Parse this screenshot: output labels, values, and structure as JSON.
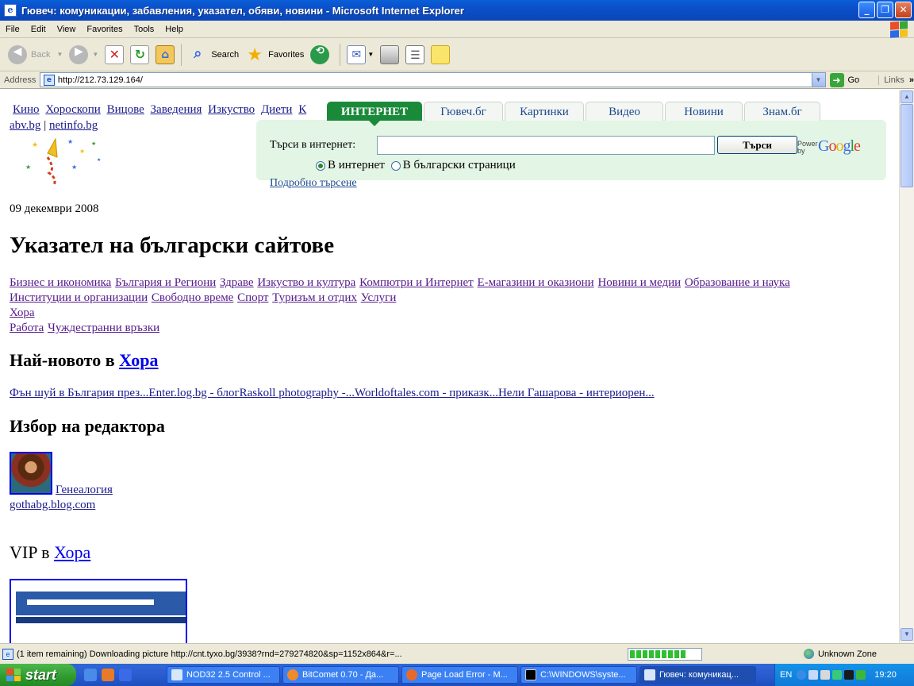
{
  "window": {
    "title": "Гювеч: комуникации, забавления, указател, обяви, новини - Microsoft Internet Explorer",
    "controls": [
      "minimize",
      "maximize",
      "close"
    ]
  },
  "menu": [
    "File",
    "Edit",
    "View",
    "Favorites",
    "Tools",
    "Help"
  ],
  "toolbar": {
    "back_label": "Back",
    "search_label": "Search",
    "favorites_label": "Favorites"
  },
  "address": {
    "label": "Address",
    "url": "http://212.73.129.164/",
    "go_label": "Go",
    "links_label": "Links"
  },
  "page": {
    "top_nav": [
      "Кино",
      "Хороскопи",
      "Вицове",
      "Заведения",
      "Изкуство",
      "Диети",
      "К"
    ],
    "top_links": [
      "abv.bg",
      "netinfo.bg"
    ],
    "tabs": [
      {
        "label": "ИНТЕРНЕТ",
        "active": true
      },
      {
        "label": "Гювеч.бг",
        "active": false
      },
      {
        "label": "Картинки",
        "active": false
      },
      {
        "label": "Видео",
        "active": false
      },
      {
        "label": "Новини",
        "active": false
      },
      {
        "label": "Знам.бг",
        "active": false
      }
    ],
    "search": {
      "label": "Търси в интернет:",
      "button": "Търси",
      "powered_by": "Powered by",
      "brand": "Google",
      "radio_internet": "В интернет",
      "radio_bg": "В български страници",
      "advanced": "Подробно търсене"
    },
    "date": "09 декември 2008",
    "heading": "Указател на български сайтове",
    "categories": [
      "Бизнес и икономика",
      "България и Региони",
      "Здраве",
      "Изкуство и култура",
      "Компютри и Интернет",
      "Е-магазини и оказиони",
      "Новини и медии",
      "Образование и наука",
      "Институции и организации",
      "Свободно време",
      "Спорт",
      "Туризъм и отдих",
      "Услуги"
    ],
    "categories_line3": "Хора",
    "categories_line4": [
      "Работа",
      "Чуждестранни връзки"
    ],
    "newest_heading_prefix": "Най-новото в",
    "newest_heading_link": "Хора",
    "newest_links": "Фън шуй в България през...Enter.log.bg - блогRaskoll photography -...Worldoftales.com - приказк...Нели Гашарова - интериорен...",
    "editor_heading": "Избор на редактора",
    "editor_link": "Генеалогия",
    "editor_sub": "gothabg.blog.com",
    "vip_prefix": "VIP в",
    "vip_link": "Хора"
  },
  "status": {
    "text": "(1 item remaining) Downloading picture http://cnt.tyxo.bg/3938?rnd=279274820&sp=1152x864&r=...",
    "progress": 0.85,
    "zone": "Unknown Zone"
  },
  "taskbar": {
    "start": "start",
    "tasks": [
      {
        "label": "NOD32 2.5 Control ...",
        "active": false
      },
      {
        "label": "BitComet 0.70 - Да...",
        "active": false
      },
      {
        "label": "Page Load Error - M...",
        "active": false
      },
      {
        "label": "C:\\WINDOWS\\syste...",
        "active": false
      },
      {
        "label": "Гювеч: комуникац...",
        "active": true
      }
    ],
    "lang": "EN",
    "clock": "19:20"
  },
  "colors": {
    "titlebar": "#0a5fd8",
    "tab_active": "#1a8a3a",
    "search_bg": "#e3f5e4",
    "visited_link": "#551a8b",
    "link": "#0000ee"
  }
}
